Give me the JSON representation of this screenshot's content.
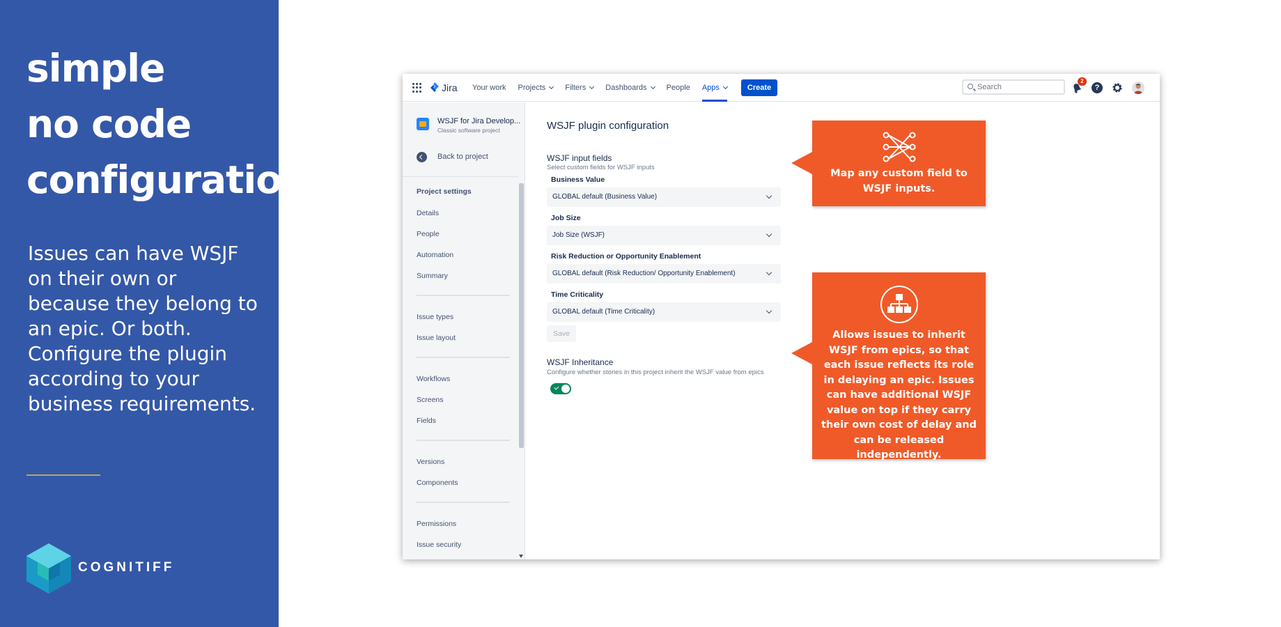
{
  "promo": {
    "headline": [
      "simple",
      "no code",
      "configuration"
    ],
    "body": "Issues can have WSJF on their own or because they belong to an epic. Or both. Configure the plugin according to your business requirements.",
    "logo_text": "COGNITIFF"
  },
  "topbar": {
    "product": "Jira",
    "nav": [
      {
        "label": "Your work",
        "dropdown": false
      },
      {
        "label": "Projects",
        "dropdown": true
      },
      {
        "label": "Filters",
        "dropdown": true
      },
      {
        "label": "Dashboards",
        "dropdown": true
      },
      {
        "label": "People",
        "dropdown": false
      },
      {
        "label": "Apps",
        "dropdown": true,
        "active": true
      }
    ],
    "create_label": "Create",
    "search_placeholder": "Search",
    "notification_count": "2",
    "help_glyph": "?",
    "icons": [
      "app-switcher-icon",
      "jira-logo-icon",
      "search-icon",
      "notification-bell-icon",
      "help-icon",
      "settings-gear-icon",
      "user-avatar"
    ]
  },
  "sidebar": {
    "project_name": "WSJF for Jira Develop...",
    "project_type": "Classic software project",
    "back_label": "Back to project",
    "heading": "Project settings",
    "groups": [
      [
        "Details",
        "People",
        "Automation",
        "Summary"
      ],
      [
        "Issue types",
        "Issue layout"
      ],
      [
        "Workflows",
        "Screens",
        "Fields"
      ],
      [
        "Versions",
        "Components"
      ],
      [
        "Permissions",
        "Issue security"
      ]
    ]
  },
  "main": {
    "title": "WSJF plugin configuration",
    "input_section_title": "WSJF input fields",
    "input_section_subtitle": "Select custom fields for WSJF inputs",
    "fields": [
      {
        "label": "Business Value",
        "value": "GLOBAL default (Business Value)"
      },
      {
        "label": "Job Size",
        "value": "Job Size (WSJF)"
      },
      {
        "label": "Risk Reduction or Opportunity Enablement",
        "value": "GLOBAL default (Risk Reduction/ Opportunity Enablement)"
      },
      {
        "label": "Time Criticality",
        "value": "GLOBAL default (Time Criticality)"
      }
    ],
    "save_label": "Save",
    "inheritance_title": "WSJF Inheritance",
    "inheritance_subtitle": "Configure whether stories in this project inherit the WSJF value from epics",
    "inheritance_enabled": true
  },
  "callouts": [
    {
      "icon": "field-mapping-icon",
      "text": "Map any custom  field to WSJF inputs."
    },
    {
      "icon": "hierarchy-icon",
      "text": "Allows issues to inherit WSJF from epics, so that each issue reflects its role in delaying an epic. Issues can have additional WSJF value on top if they carry their own cost of delay and can be released independently."
    }
  ],
  "colors": {
    "promo_bg": "#3458a8",
    "accent_orange": "#f05a28",
    "jira_blue": "#0052cc",
    "toggle_green": "#00875a"
  }
}
